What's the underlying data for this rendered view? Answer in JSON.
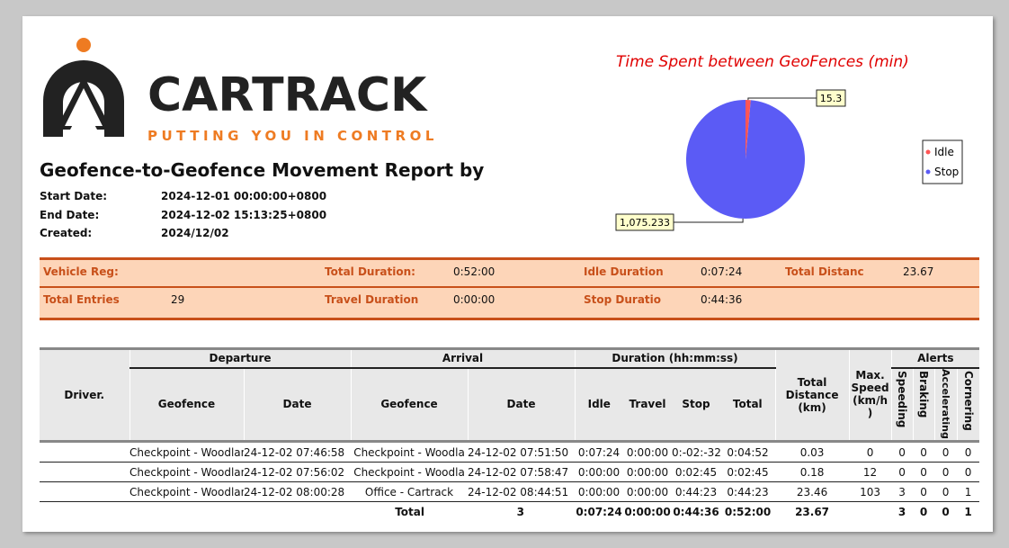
{
  "brand": {
    "name": "CARTRACK",
    "tagline": "PUTTING YOU IN CONTROL",
    "accent": "#ee7b22",
    "dark": "#222222"
  },
  "report": {
    "title": "Geofence-to-Geofence Movement Report by",
    "start_label": "Start Date:",
    "start_value": "2024-12-01 00:00:00+0800",
    "end_label": "End Date:",
    "end_value": "2024-12-02 15:13:25+0800",
    "created_label": "Created:",
    "created_value": "2024/12/02"
  },
  "chart_data": {
    "type": "pie",
    "title": "Time Spent between GeoFences (min)",
    "categories": [
      "Idle",
      "Stop"
    ],
    "values": [
      15.3,
      1075.233
    ],
    "value_labels": [
      "15.3",
      "1,075.233"
    ],
    "colors": [
      "#ff5555",
      "#5b5bf5"
    ],
    "legend": "right"
  },
  "summary": {
    "vehicle_reg_label": "Vehicle Reg:",
    "vehicle_reg_value": "",
    "total_duration_label": "Total Duration:",
    "total_duration_value": "0:52:00",
    "idle_duration_label": "Idle Duration",
    "idle_duration_value": "0:07:24",
    "total_distance_label": "Total Distanc",
    "total_distance_value": "23.67",
    "total_entries_label": "Total Entries",
    "total_entries_value": "29",
    "travel_duration_label": "Travel Duration",
    "travel_duration_value": "0:00:00",
    "stop_duration_label": "Stop Duratio",
    "stop_duration_value": "0:44:36",
    "color_label": "#c8501a",
    "color_bg": "#fdd5b8"
  },
  "table": {
    "h_driver": "Driver.",
    "h_departure": "Departure",
    "h_arrival": "Arrival",
    "h_duration": "Duration (hh:mm:ss)",
    "h_alerts": "Alerts",
    "h_dep_geofence": "Geofence",
    "h_dep_date": "Date",
    "h_arr_geofence": "Geofence",
    "h_arr_date": "Date",
    "h_idle": "Idle",
    "h_travel": "Travel",
    "h_stop": "Stop",
    "h_total": "Total",
    "h_distance": "Total Distance (km)",
    "h_speed": "Max. Speed (km/h\n)",
    "h_speeding": "Speeding",
    "h_braking": "Braking",
    "h_accelerating": "Accelerating",
    "h_cornering": "Cornering",
    "rows": [
      {
        "driver": "",
        "dep_geofence": "Checkpoint - Woodlan",
        "dep_date": "24-12-02  07:46:58",
        "arr_geofence": "Checkpoint - Woodla",
        "arr_date": "24-12-02  07:51:50",
        "idle": "0:07:24",
        "travel": "0:00:00",
        "stop": "0:-02:-32",
        "total": "0:04:52",
        "distance": "0.03",
        "speed": "0",
        "speeding": "0",
        "braking": "0",
        "accelerating": "0",
        "cornering": "0"
      },
      {
        "driver": "",
        "dep_geofence": "Checkpoint - Woodlan",
        "dep_date": "24-12-02  07:56:02",
        "arr_geofence": "Checkpoint - Woodla",
        "arr_date": "24-12-02  07:58:47",
        "idle": "0:00:00",
        "travel": "0:00:00",
        "stop": "0:02:45",
        "total": "0:02:45",
        "distance": "0.18",
        "speed": "12",
        "speeding": "0",
        "braking": "0",
        "accelerating": "0",
        "cornering": "0"
      },
      {
        "driver": "",
        "dep_geofence": "Checkpoint - Woodlan",
        "dep_date": "24-12-02  08:00:28",
        "arr_geofence": "Office - Cartrack",
        "arr_date": "24-12-02  08:44:51",
        "idle": "0:00:00",
        "travel": "0:00:00",
        "stop": "0:44:23",
        "total": "0:44:23",
        "distance": "23.46",
        "speed": "103",
        "speeding": "3",
        "braking": "0",
        "accelerating": "0",
        "cornering": "1"
      }
    ],
    "totals": {
      "label": "Total",
      "count": "3",
      "idle": "0:07:24",
      "travel": "0:00:00",
      "stop": "0:44:36",
      "total": "0:52:00",
      "distance": "23.67",
      "speeding": "3",
      "braking": "0",
      "accelerating": "0",
      "cornering": "1"
    }
  }
}
